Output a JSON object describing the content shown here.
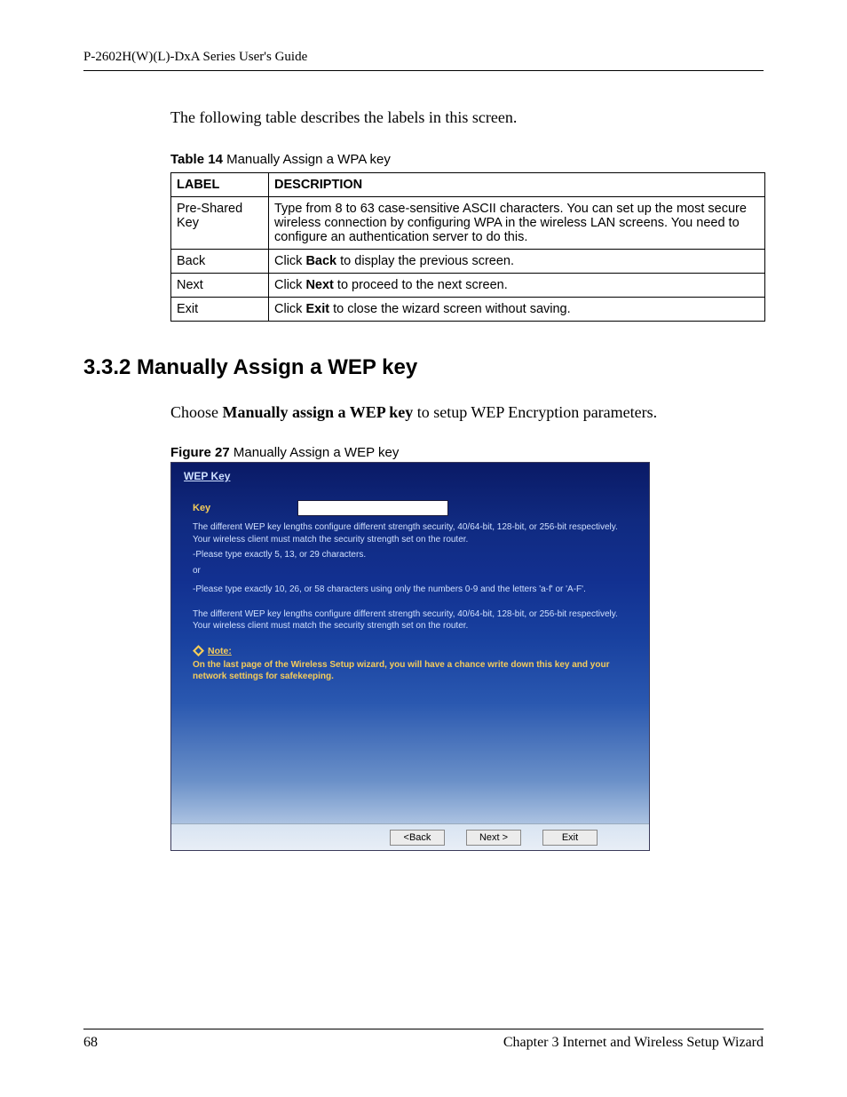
{
  "header": {
    "running_title": "P-2602H(W)(L)-DxA Series User's Guide"
  },
  "intro": "The following table describes the labels in this screen.",
  "table14": {
    "caption_prefix": "Table 14",
    "caption_text": "   Manually Assign a WPA key",
    "head_label": "LABEL",
    "head_desc": "DESCRIPTION",
    "rows": [
      {
        "label": "Pre-Shared Key",
        "desc_pre": "Type from 8 to 63 case-sensitive ASCII characters. You can set up the most secure wireless connection by configuring WPA in the wireless LAN screens. You need to configure an authentication server to do this.",
        "bold": "",
        "desc_post": ""
      },
      {
        "label": "Back",
        "desc_pre": "Click ",
        "bold": "Back",
        "desc_post": " to display the previous screen."
      },
      {
        "label": "Next",
        "desc_pre": "Click ",
        "bold": "Next",
        "desc_post": " to proceed to the next screen."
      },
      {
        "label": "Exit",
        "desc_pre": "Click ",
        "bold": "Exit",
        "desc_post": " to close the wizard screen without saving."
      }
    ]
  },
  "section": {
    "heading": "3.3.2  Manually Assign a WEP key",
    "choose_pre": "Choose ",
    "choose_bold": "Manually assign a WEP key",
    "choose_post": " to setup WEP Encryption parameters."
  },
  "figure27": {
    "caption_prefix": "Figure 27",
    "caption_text": "   Manually Assign a WEP key"
  },
  "wizard": {
    "title": "WEP Key",
    "key_label": "Key",
    "key_value": "",
    "text1": "The different WEP key lengths configure different strength security, 40/64-bit, 128-bit, or 256-bit respectively. Your wireless client must match the security strength set on the router.",
    "text2": "-Please type exactly 5, 13, or 29 characters.",
    "text_or": "or",
    "text3": "-Please type exactly 10, 26, or 58 characters using only the numbers 0-9 and the letters 'a-f' or 'A-F'.",
    "text4": "The different WEP key lengths configure different strength security, 40/64-bit, 128-bit, or 256-bit respectively. Your wireless client must match the security strength set on the router.",
    "note_label": "Note:",
    "note_body": "On the last page of the Wireless Setup wizard, you will have a chance write down this key and your network settings for safekeeping.",
    "btn_back": "<Back",
    "btn_next": "Next >",
    "btn_exit": "Exit"
  },
  "footer": {
    "page_no": "68",
    "chapter": "Chapter 3 Internet and Wireless Setup Wizard"
  }
}
